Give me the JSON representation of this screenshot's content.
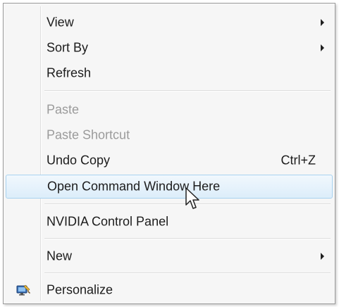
{
  "menu": {
    "items": [
      {
        "label": "View",
        "submenu": true
      },
      {
        "label": "Sort By",
        "submenu": true
      },
      {
        "label": "Refresh"
      },
      {
        "label": "Paste",
        "disabled": true
      },
      {
        "label": "Paste Shortcut",
        "disabled": true
      },
      {
        "label": "Undo Copy",
        "shortcut": "Ctrl+Z"
      },
      {
        "label": "Open Command Window Here",
        "highlighted": true
      },
      {
        "label": "NVIDIA Control Panel"
      },
      {
        "label": "New",
        "submenu": true
      },
      {
        "label": "Personalize",
        "icon": "personalize-icon"
      }
    ]
  },
  "colors": {
    "highlight_border": "#a8d2f0",
    "highlight_bg": "#dcedfa",
    "disabled_text": "#9b9b9b"
  }
}
